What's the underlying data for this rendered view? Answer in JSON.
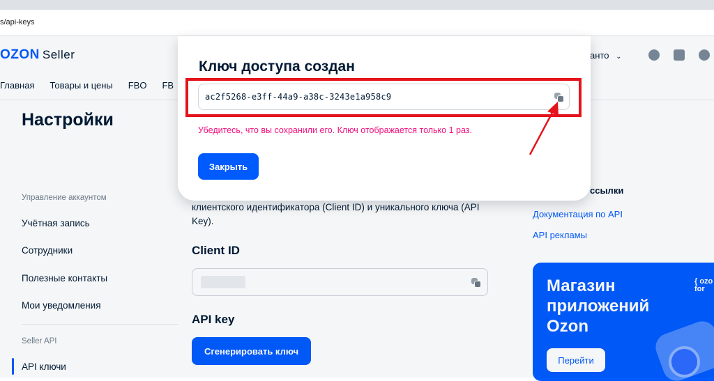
{
  "browser": {
    "url": "s/api-keys"
  },
  "header": {
    "logo_main": "OZON",
    "logo_sub": "Seller",
    "account_text": "анто",
    "nav": [
      "Главная",
      "Товары и цены",
      "FBO",
      "FB"
    ]
  },
  "sidebar": {
    "title": "Настройки",
    "section_account": "Управление аккаунтом",
    "items": [
      "Учётная запись",
      "Сотрудники",
      "Полезные контакты",
      "Мои уведомления"
    ],
    "section_api": "Seller API",
    "active_item": "API ключи"
  },
  "main": {
    "description": "клиентского идентификатора (Client ID) и уникального ключа (API Key).",
    "client_id_label": "Client ID",
    "api_key_label": "API key",
    "generate_button": "Сгенерировать ключ"
  },
  "right": {
    "links_heading": "ссылки",
    "links": [
      "Документация по API",
      "API рекламы"
    ],
    "promo": {
      "title": "Магазин приложений Ozon",
      "button": "Перейти",
      "brand": "{ ozo for"
    }
  },
  "modal": {
    "title": "Ключ доступа создан",
    "key_value": "ac2f5268-e3ff-44a9-a38c-3243e1a958c9",
    "warning": "Убедитесь, что вы сохранили его. Ключ отображается только 1 раз.",
    "close_button": "Закрыть"
  },
  "colors": {
    "brand": "#005bff",
    "warning": "#f1117e",
    "highlight": "#e4131c"
  }
}
